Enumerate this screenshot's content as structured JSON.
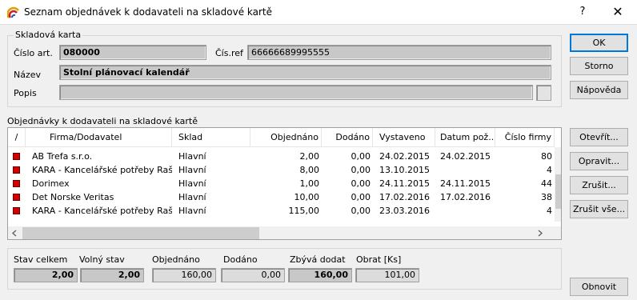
{
  "window": {
    "title": "Seznam objednávek k dodavateli na skladové kartě",
    "help_label": "?",
    "close_label": "✕"
  },
  "card": {
    "group_label": "Skladová karta",
    "article_no_label": "Číslo art.",
    "article_no_value": "080000",
    "ref_no_label": "Čís.ref",
    "ref_no_value": "66666689995555",
    "name_label": "Název",
    "name_value": "Stolní plánovací kalendář",
    "desc_label": "Popis",
    "desc_value": ""
  },
  "buttons": {
    "ok": "OK",
    "cancel": "Storno",
    "help": "Nápověda",
    "open": "Otevřít...",
    "edit": "Opravit...",
    "cancel_order": "Zrušit...",
    "cancel_all": "Zrušit vše...",
    "refresh": "Obnovit"
  },
  "orders": {
    "label": "Objednávky k dodavateli na skladové kartě",
    "sort_indicator": "/",
    "columns": [
      "Firma/Dodavatel",
      "Sklad",
      "Objednáno",
      "Dodáno",
      "Vystaveno",
      "Datum pož...",
      "Číslo firmy"
    ],
    "rows": [
      [
        "AB Trefa s.r.o.",
        "Hlavní",
        "2,00",
        "0,00",
        "24.02.2015",
        "24.02.2015",
        "80"
      ],
      [
        "KARA - Kancelářské potřeby Rašín",
        "Hlavní",
        "8,00",
        "0,00",
        "13.10.2015",
        "",
        "4"
      ],
      [
        "Dorimex",
        "Hlavní",
        "1,00",
        "0,00",
        "24.11.2015",
        "24.11.2015",
        "44"
      ],
      [
        "Det Norske Veritas",
        "Hlavní",
        "10,00",
        "0,00",
        "17.02.2016",
        "17.02.2016",
        "38"
      ],
      [
        "KARA - Kancelářské potřeby Rašín",
        "Hlavní",
        "115,00",
        "0,00",
        "23.03.2016",
        "",
        "4"
      ]
    ],
    "marker_color": "#d40000"
  },
  "summary": {
    "stock_label": "Stav celkem",
    "stock_value": "2,00",
    "free_label": "Volný stav",
    "free_value": "2,00",
    "ordered_label": "Objednáno",
    "ordered_value": "160,00",
    "delivered_label": "Dodáno",
    "delivered_value": "0,00",
    "remaining_label": "Zbývá dodat",
    "remaining_value": "160,00",
    "turnover_label": "Obrat [Ks]",
    "turnover_value": "101,00"
  },
  "icons": {
    "app": "app-logo-icon",
    "help": "help-icon",
    "close": "close-icon",
    "scroll_left": "chevron-left-icon",
    "scroll_right": "chevron-right-icon"
  }
}
